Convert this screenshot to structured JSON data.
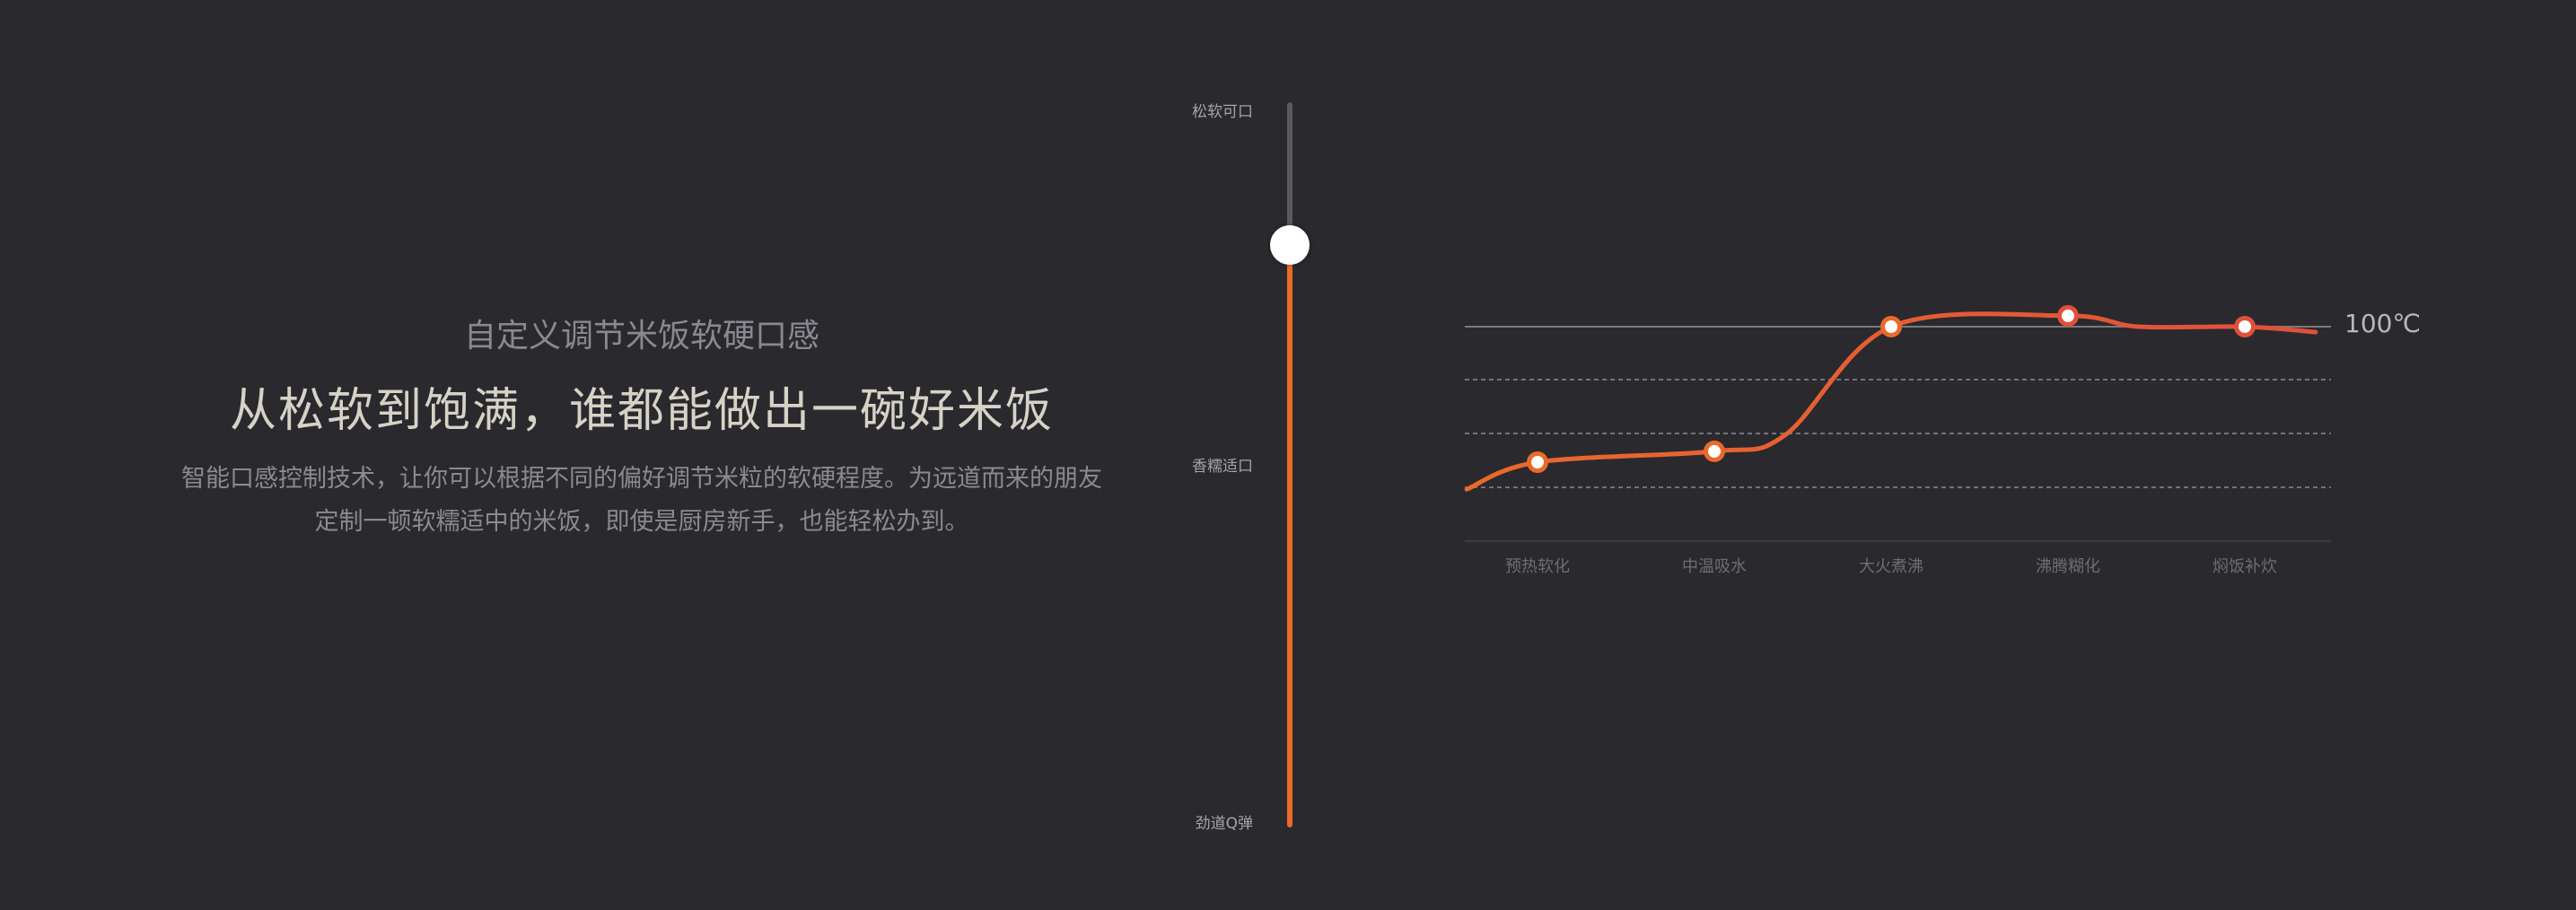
{
  "intro": {
    "subtitle": "自定义调节米饭软硬口感",
    "title": "从松软到饱满，谁都能做出一碗好米饭",
    "desc_line1": "智能口感控制技术，让你可以根据不同的偏好调节米粒的软硬程度。为远道而来的朋友",
    "desc_line2": "定制一顿软糯适中的米饭，即使是厨房新手，也能轻松办到。"
  },
  "slider": {
    "label_top": "松软可口",
    "label_mid": "香糯适口",
    "label_bottom": "劲道Q弹",
    "value_fraction_from_top": 0.2
  },
  "colors": {
    "background": "#2a292e",
    "accent": "#ea6a2a",
    "accent_end": "#e0503c",
    "track": "#5b5a60"
  },
  "chart_data": {
    "type": "line",
    "categories": [
      "预热软化",
      "中温吸水",
      "大火煮沸",
      "沸腾糊化",
      "焖饭补炊"
    ],
    "reference_line": {
      "label": "100℃",
      "value": 100
    },
    "grid": "dashed horizontal",
    "series": [
      {
        "points": [
          {
            "x": -0.4,
            "y": 70
          },
          {
            "x": 0,
            "y": 75
          },
          {
            "x": 1,
            "y": 77
          },
          {
            "x": 1.4,
            "y": 80
          },
          {
            "x": 2,
            "y": 100
          },
          {
            "x": 3,
            "y": 102
          },
          {
            "x": 3.4,
            "y": 100
          },
          {
            "x": 4,
            "y": 100
          },
          {
            "x": 4.4,
            "y": 99
          }
        ],
        "markers": [
          {
            "category": "预热软化",
            "y": 75
          },
          {
            "category": "中温吸水",
            "y": 77
          },
          {
            "category": "大火煮沸",
            "y": 100
          },
          {
            "category": "沸腾糊化",
            "y": 102
          },
          {
            "category": "焖饭补炊",
            "y": 100
          }
        ]
      }
    ]
  }
}
